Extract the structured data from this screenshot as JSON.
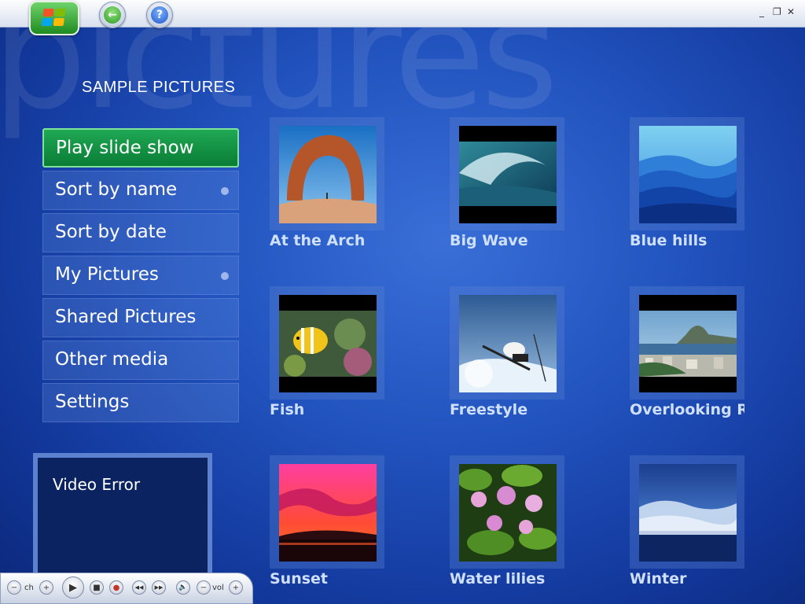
{
  "watermark": "pictures",
  "page_title": "SAMPLE PICTURES",
  "topbar": {
    "start_icon": "windows-logo-icon",
    "back_icon": "back-arrow-icon",
    "help_icon": "help-icon",
    "help_glyph": "?",
    "back_glyph": "←",
    "minimize_glyph": "_",
    "restore_glyph": "❐",
    "close_glyph": "✕"
  },
  "menu": {
    "items": [
      {
        "label": "Play slide show",
        "active": true,
        "dot": false
      },
      {
        "label": "Sort by name",
        "active": false,
        "dot": true
      },
      {
        "label": "Sort by date",
        "active": false,
        "dot": false
      },
      {
        "label": "My Pictures",
        "active": false,
        "dot": true
      },
      {
        "label": "Shared Pictures",
        "active": false,
        "dot": false
      },
      {
        "label": "Other media",
        "active": false,
        "dot": false
      },
      {
        "label": "Settings",
        "active": false,
        "dot": false
      }
    ]
  },
  "video": {
    "message": "Video Error"
  },
  "transport": {
    "ch_label": "ch",
    "vol_label": "vol",
    "minus": "−",
    "plus": "+",
    "play": "▶",
    "stop": "■",
    "record": "●",
    "rewind": "◀◀",
    "forward": "▶▶",
    "mute": "🔈"
  },
  "pictures": [
    {
      "label": "At the Arch",
      "thumb": "arch"
    },
    {
      "label": "Big Wave",
      "thumb": "wave"
    },
    {
      "label": "Blue hills",
      "thumb": "hills"
    },
    {
      "label": "Fish",
      "thumb": "fish"
    },
    {
      "label": "Freestyle",
      "thumb": "ski"
    },
    {
      "label": "Overlooking Ri",
      "thumb": "city"
    },
    {
      "label": "Sunset",
      "thumb": "sunset"
    },
    {
      "label": "Water lilies",
      "thumb": "lilies"
    },
    {
      "label": "Winter",
      "thumb": "winter"
    }
  ],
  "colors": {
    "background": "#2152bd",
    "active_green": "#1fa855",
    "label_blue": "#cfe0ff"
  }
}
